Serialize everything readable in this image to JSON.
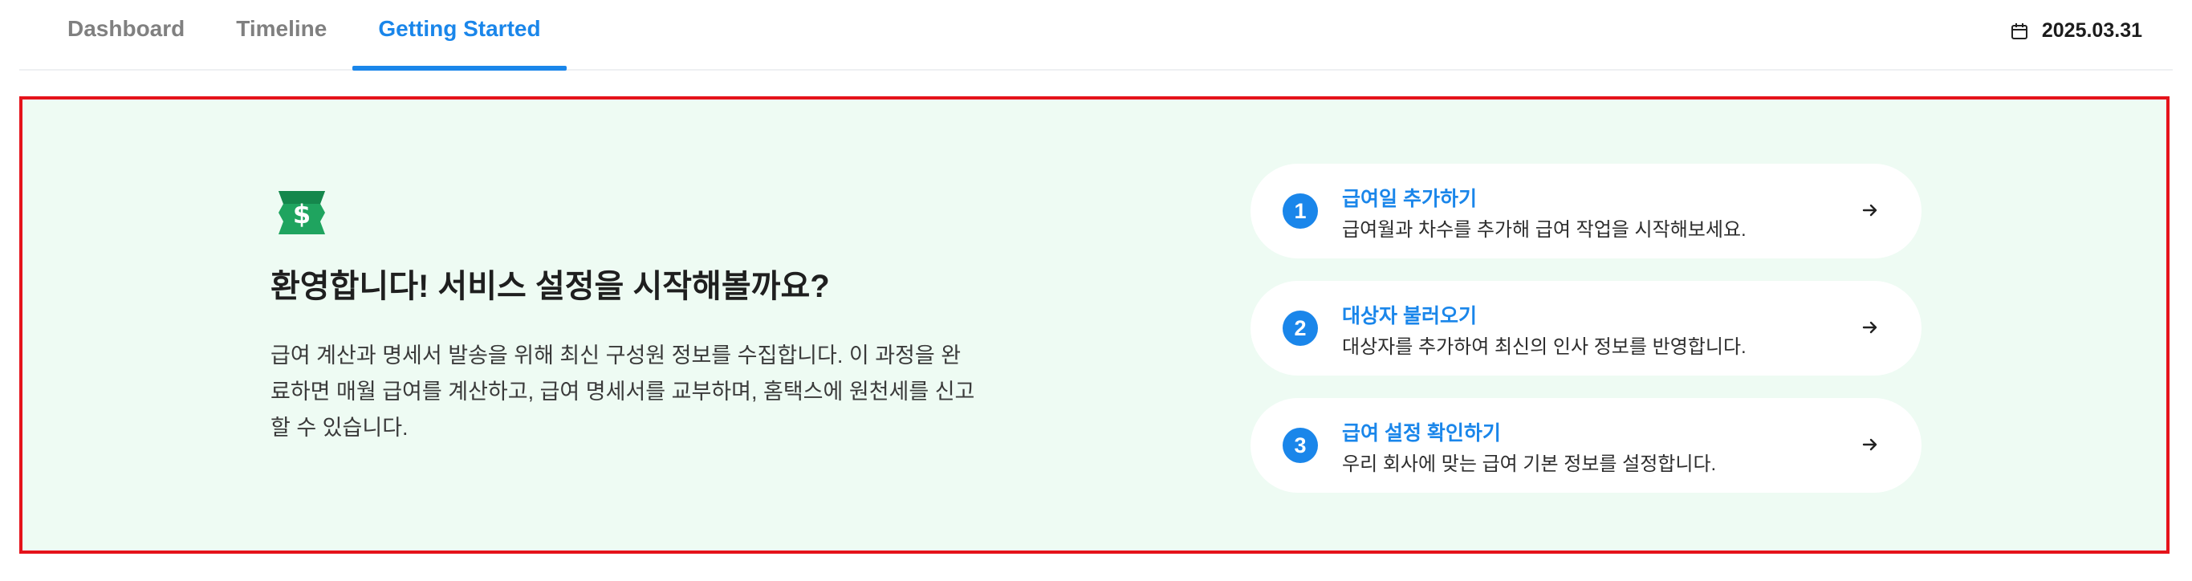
{
  "tabs": [
    {
      "label": "Dashboard",
      "active": false
    },
    {
      "label": "Timeline",
      "active": false
    },
    {
      "label": "Getting Started",
      "active": true
    }
  ],
  "date": {
    "icon": "calendar-icon",
    "value": "2025.03.31"
  },
  "welcome": {
    "icon": "money-icon",
    "title": "환영합니다! 서비스 설정을 시작해볼까요?",
    "description": "급여 계산과 명세서 발송을 위해 최신 구성원 정보를 수집합니다. 이 과정을 완료하면 매월 급여를 계산하고, 급여 명세서를 교부하며, 홈택스에 원천세를 신고할 수 있습니다."
  },
  "steps": [
    {
      "number": "1",
      "title": "급여일 추가하기",
      "description": "급여월과 차수를 추가해 급여 작업을 시작해보세요."
    },
    {
      "number": "2",
      "title": "대상자 불러오기",
      "description": "대상자를 추가하여 최신의 인사 정보를 반영합니다."
    },
    {
      "number": "3",
      "title": "급여 설정 확인하기",
      "description": "우리 회사에 맞는 급여 기본 정보를 설정합니다."
    }
  ],
  "colors": {
    "accent": "#1a86ea",
    "panel_bg": "#eefbf3",
    "highlight_border": "#e5131b",
    "money_green": "#1fa45f"
  }
}
